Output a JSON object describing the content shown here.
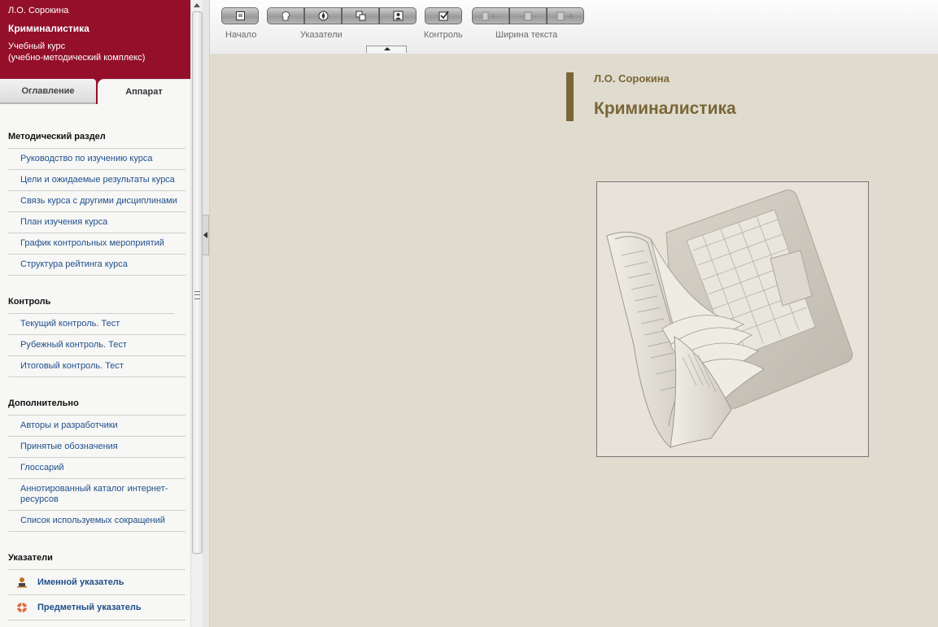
{
  "sidebar": {
    "author": "Л.О. Сорокина",
    "course": "Криминалистика",
    "type_line1": "Учебный курс",
    "type_line2": "(учебно-методический комплекс)",
    "tabs": [
      "Оглавление",
      "Аппарат"
    ],
    "sections": [
      {
        "title": "Методический раздел",
        "items": [
          "Руководство по изучению курса",
          "Цели и ожидаемые результаты курса",
          "Связь курса с другими дисциплинами",
          "План изучения курса",
          "График контрольных мероприятий",
          "Структура рейтинга курса"
        ]
      },
      {
        "title": "Контроль",
        "items": [
          "Текущий контроль. Тест",
          "Рубежный контроль. Тест",
          "Итоговый контроль. Тест"
        ]
      },
      {
        "title": "Дополнительно",
        "items": [
          "Авторы и разработчики",
          "Принятые обозначения",
          "Глоссарий",
          "Аннотированный каталог интернет-ресурсов",
          "Список используемых сокращений"
        ]
      },
      {
        "title": "Указатели",
        "items": [
          "Именной указатель",
          "Предметный указатель"
        ]
      }
    ]
  },
  "toolbar": {
    "labels": [
      "Начало",
      "Указатели",
      "Контроль",
      "Ширина текста"
    ],
    "icons": [
      "home-icon",
      "person-index-icon",
      "subject-index-icon",
      "copy-icon",
      "portrait-icon",
      "checkbox-icon",
      "narrow-text-icon",
      "medium-text-icon",
      "wide-text-icon"
    ]
  },
  "content": {
    "author": "Л.О. Сорокина",
    "title": "Криминалистика",
    "cover_image": "open-book-laptop-illustration"
  },
  "colors": {
    "brand": "#940f2a",
    "accent": "#7a6636",
    "link": "#1f4f8c",
    "background": "#dfdbcf"
  }
}
